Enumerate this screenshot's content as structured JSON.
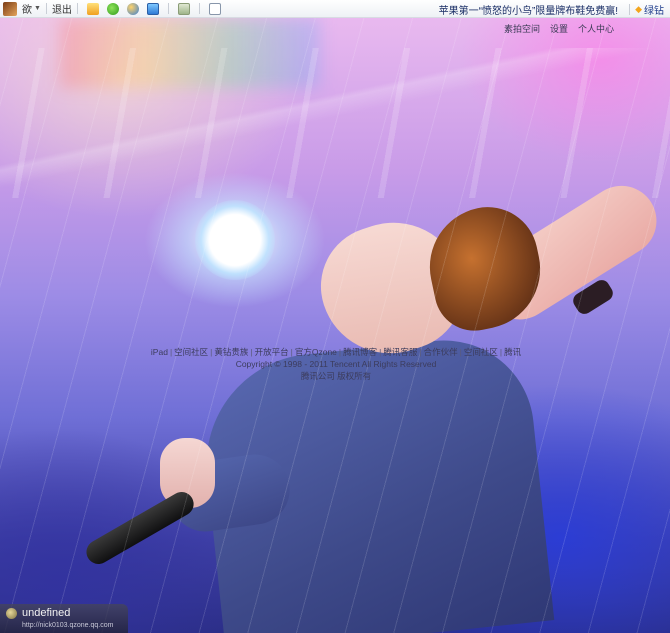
{
  "toolbar": {
    "username": "欲",
    "logout": "退出",
    "marquee": "苹果第一“愤怒的小鸟”限量牌布鞋免费赢!",
    "vip": "绿钻"
  },
  "topnav": {
    "items": [
      "素拍空间",
      "设置",
      "个人中心"
    ]
  },
  "footer": {
    "links": [
      "iPad",
      "空间社区",
      "黄钻贵族",
      "开放平台",
      "官方Qzone",
      "腾讯博客",
      "腾讯客服",
      "合作伙伴",
      "空间社区",
      "腾讯"
    ],
    "copyright": "Copyright © 1998 - 2011 Tencent All Rights Reserved",
    "company": "腾讯公司 版权所有"
  },
  "badge": {
    "name": "undefined",
    "url": "http://nick0103.qzone.qq.com"
  }
}
